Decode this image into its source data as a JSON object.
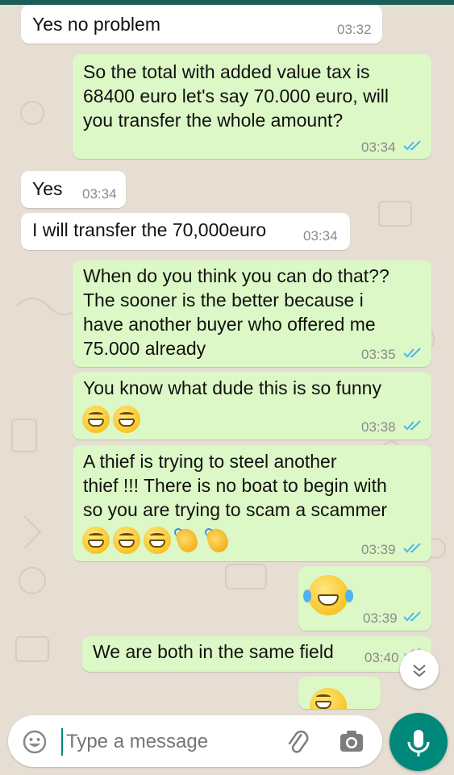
{
  "messages": [
    {
      "id": "m1",
      "dir": "in",
      "text": "Yes no problem",
      "time": "03:32"
    },
    {
      "id": "m2",
      "dir": "out",
      "text": "So the total with added value tax is\n68400 euro let's say 70.000 euro, will\nyou transfer the whole amount?",
      "time": "03:34",
      "status": "read"
    },
    {
      "id": "m3",
      "dir": "in",
      "text": "Yes",
      "time": "03:34"
    },
    {
      "id": "m4",
      "dir": "in",
      "text": "I will transfer the 70,000euro",
      "time": "03:34"
    },
    {
      "id": "m5",
      "dir": "out",
      "text": "When do you think you can do that??\nThe sooner is the better because i\nhave another buyer who offered me\n75.000 already",
      "time": "03:35",
      "status": "read"
    },
    {
      "id": "m6",
      "dir": "out",
      "text": "You know what dude this is so funny",
      "emoji": [
        "grinning-face",
        "grinning-face"
      ],
      "time": "03:38",
      "status": "read"
    },
    {
      "id": "m7",
      "dir": "out",
      "text": "A thief is trying to steel another\nthief !!! There is no boat to begin with\nso you are trying to scam a scammer",
      "emoji": [
        "grinning-face",
        "grinning-face",
        "grinning-face",
        "clapping-hands",
        "clapping-hands"
      ],
      "time": "03:39",
      "status": "read"
    },
    {
      "id": "m8",
      "dir": "out",
      "text": "",
      "emoji": [
        "face-with-tears-of-joy"
      ],
      "time": "03:39",
      "status": "read"
    },
    {
      "id": "m9",
      "dir": "out",
      "text": "We are both in the same field",
      "time": "03:40",
      "status": "sent"
    },
    {
      "id": "m10",
      "dir": "out",
      "text": "",
      "emoji": [
        "grinning-face"
      ],
      "time": ""
    }
  ],
  "composer": {
    "placeholder": "Type a message",
    "emoji_icon": "emoji-icon",
    "attach_icon": "paperclip-icon",
    "camera_icon": "camera-icon",
    "mic_icon": "microphone-icon"
  },
  "scroll_down_icon": "double-chevron-down-icon",
  "colors": {
    "outgoing": "#dcf8c6",
    "incoming": "#ffffff",
    "read_ticks": "#4fb6ec",
    "accent": "#00897b",
    "header": "#1b5e57"
  }
}
